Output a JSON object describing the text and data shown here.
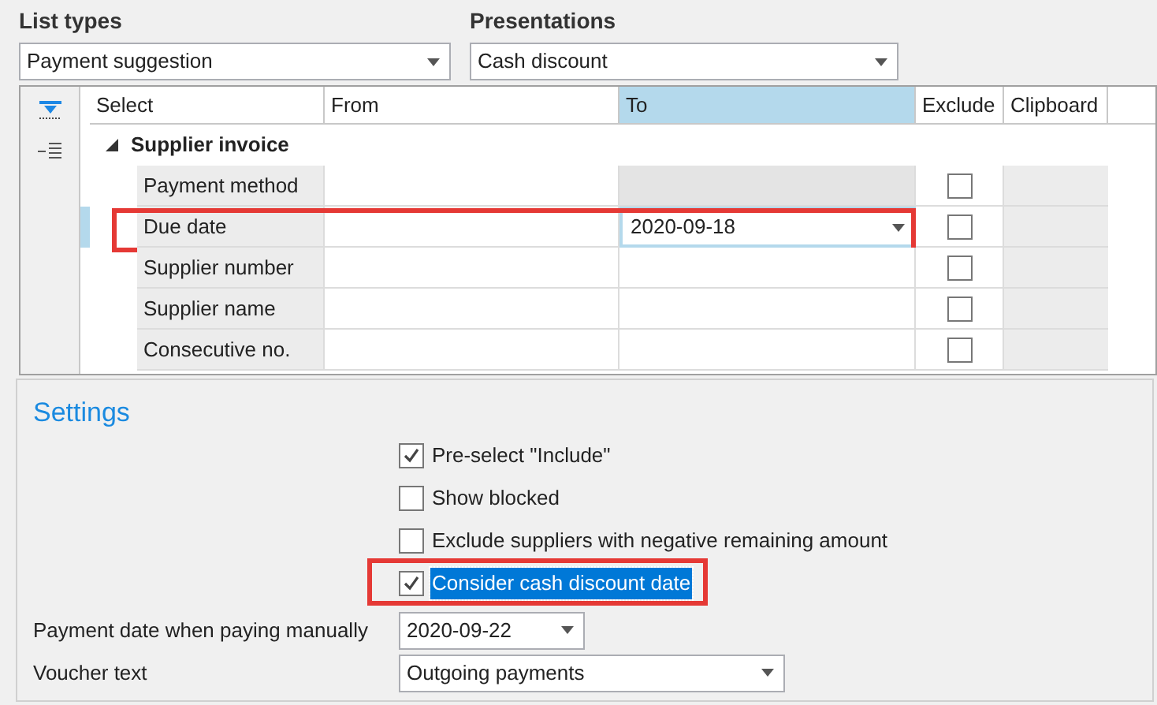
{
  "list_types": {
    "label": "List types",
    "value": "Payment suggestion"
  },
  "presentations": {
    "label": "Presentations",
    "value": "Cash discount"
  },
  "grid": {
    "columns": [
      {
        "label": "Select",
        "selected": false
      },
      {
        "label": "From",
        "selected": false
      },
      {
        "label": "To",
        "selected": true
      },
      {
        "label": "Exclude",
        "selected": false
      },
      {
        "label": "Clipboard",
        "selected": false
      }
    ],
    "group": {
      "label": "Supplier invoice",
      "expanded": true
    },
    "rows": [
      {
        "label": "Payment method",
        "to_disabled": true,
        "current": false,
        "highlighted": false,
        "exclude": false
      },
      {
        "label": "Due date",
        "to": "2020-09-18",
        "to_disabled": false,
        "current": true,
        "highlighted": true,
        "exclude": false
      },
      {
        "label": "Supplier number",
        "to_disabled": false,
        "current": false,
        "highlighted": false,
        "exclude": false
      },
      {
        "label": "Supplier name",
        "to_disabled": false,
        "current": false,
        "highlighted": false,
        "exclude": false
      },
      {
        "label": "Consecutive no.",
        "to_disabled": false,
        "current": false,
        "highlighted": false,
        "exclude": false
      }
    ]
  },
  "settings": {
    "title": "Settings",
    "options": [
      {
        "label": "Pre-select \"Include\"",
        "checked": true,
        "selected": false,
        "highlighted": false
      },
      {
        "label": "Show blocked",
        "checked": false,
        "selected": false,
        "highlighted": false
      },
      {
        "label": "Exclude suppliers with negative remaining amount",
        "checked": false,
        "selected": false,
        "highlighted": false
      },
      {
        "label": "Consider cash discount date",
        "checked": true,
        "selected": true,
        "highlighted": true
      }
    ],
    "payment_date": {
      "label": "Payment date when paying manually",
      "value": "2020-09-22"
    },
    "voucher_text": {
      "label": "Voucher text",
      "value": "Outgoing payments"
    }
  }
}
